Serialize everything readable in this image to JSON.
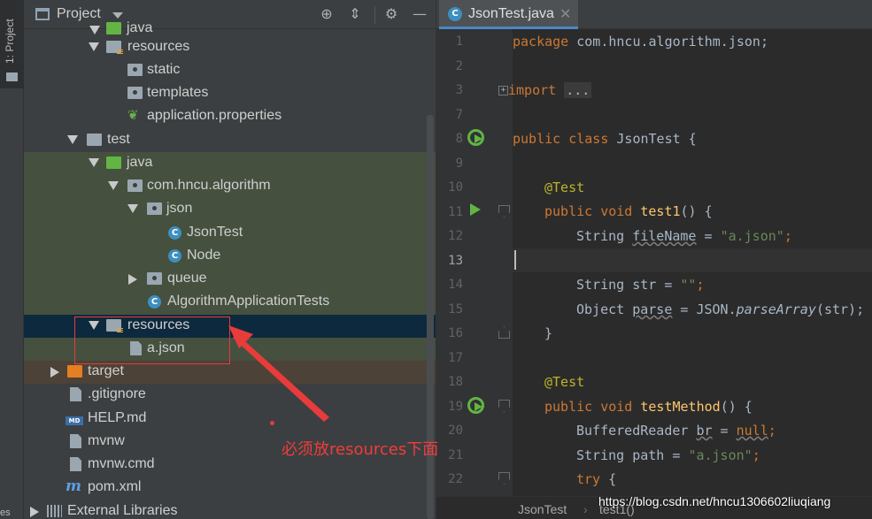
{
  "toolstrip": {
    "project_tab": "1: Project",
    "bottom_fragment": "es"
  },
  "project_panel": {
    "title": "Project",
    "tree": [
      {
        "label": "java",
        "icon": "folder-source-icon"
      },
      {
        "label": "resources",
        "icon": "folder-resources-icon"
      },
      {
        "label": "static",
        "icon": "package-folder-icon"
      },
      {
        "label": "templates",
        "icon": "package-folder-icon"
      },
      {
        "label": "application.properties",
        "icon": "spring-properties-icon"
      },
      {
        "label": "test",
        "icon": "folder-icon"
      },
      {
        "label": "java",
        "icon": "folder-test-source-icon"
      },
      {
        "label": "com.hncu.algorithm",
        "icon": "package-icon"
      },
      {
        "label": "json",
        "icon": "package-icon"
      },
      {
        "label": "JsonTest",
        "icon": "java-class-icon"
      },
      {
        "label": "Node",
        "icon": "java-class-icon"
      },
      {
        "label": "queue",
        "icon": "package-icon"
      },
      {
        "label": "AlgorithmApplicationTests",
        "icon": "java-class-icon"
      },
      {
        "label": "resources",
        "icon": "folder-test-resources-icon"
      },
      {
        "label": "a.json",
        "icon": "json-file-icon"
      },
      {
        "label": "target",
        "icon": "folder-excluded-icon"
      },
      {
        "label": ".gitignore",
        "icon": "text-file-icon"
      },
      {
        "label": "HELP.md",
        "icon": "markdown-file-icon"
      },
      {
        "label": "mvnw",
        "icon": "text-file-icon"
      },
      {
        "label": "mvnw.cmd",
        "icon": "text-file-icon"
      },
      {
        "label": "pom.xml",
        "icon": "maven-icon"
      },
      {
        "label": "External Libraries",
        "icon": "library-icon"
      }
    ]
  },
  "editor": {
    "tab": {
      "label": "JsonTest.java",
      "close": "✕"
    },
    "line_numbers": [
      "1",
      "2",
      "3",
      "7",
      "8",
      "9",
      "10",
      "11",
      "12",
      "13",
      "14",
      "15",
      "16",
      "17",
      "18",
      "19",
      "20",
      "21",
      "22"
    ],
    "current_line": "13",
    "lines": {
      "l1": {
        "kw": "package",
        "rest": " com.hncu.algorithm.json;"
      },
      "l3": {
        "kw": "import",
        "collapsed": "..."
      },
      "l8": {
        "kw": "public class",
        "name": " JsonTest {"
      },
      "l10": {
        "annotation": "@Test"
      },
      "l11": {
        "kw": "public void",
        "method": "test1",
        "rest": "() {"
      },
      "l12": {
        "type": "String ",
        "var": "fileName",
        "eq": " = ",
        "str": "\"a.json\"",
        "end": ";"
      },
      "l14": {
        "type": "String str = ",
        "str": "\"\"",
        "end": ";"
      },
      "l15": {
        "type": "Object ",
        "var": "parse",
        "mid": " = JSON.",
        "call": "parseArray",
        "end": "(str);"
      },
      "l16": {
        "text": "}"
      },
      "l18": {
        "annotation": "@Test"
      },
      "l19": {
        "kw": "public void",
        "method": "testMethod",
        "rest": "() {"
      },
      "l20": {
        "type": "BufferedReader ",
        "var": "br",
        "eq": " = ",
        "kw": "null",
        "end": ";"
      },
      "l21": {
        "type": "String path = ",
        "str": "\"a.json\"",
        "end": ";"
      },
      "l22": {
        "kw": "try",
        "rest": " {"
      }
    },
    "breadcrumb": [
      "JsonTest",
      "test1()"
    ]
  },
  "annotation": {
    "note": "必须放resources下面",
    "color": "#e83b3b"
  },
  "watermark": "https://blog.csdn.net/hncu1306602liuqiang"
}
